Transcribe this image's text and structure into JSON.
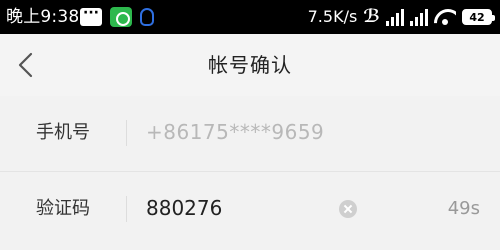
{
  "status_bar": {
    "time": "晚上9:38",
    "net_speed": "7.5K/s",
    "bluetooth": "ℬ",
    "battery": "42",
    "icons": [
      "message-icon",
      "app-notification-icon",
      "qq-icon",
      "bluetooth-icon",
      "signal-icon",
      "signal-icon",
      "wifi-icon",
      "battery-icon"
    ]
  },
  "nav": {
    "title": "帐号确认",
    "back_icon": "chevron-left-icon"
  },
  "form": {
    "phone_label": "手机号",
    "phone_value": "+86175****9659",
    "code_label": "验证码",
    "code_value": "880276",
    "countdown": "49s"
  },
  "colors": {
    "status_bar_bg": "#000000",
    "page_bg": "#f2f2f2",
    "placeholder_gray": "#b8b8b8"
  }
}
